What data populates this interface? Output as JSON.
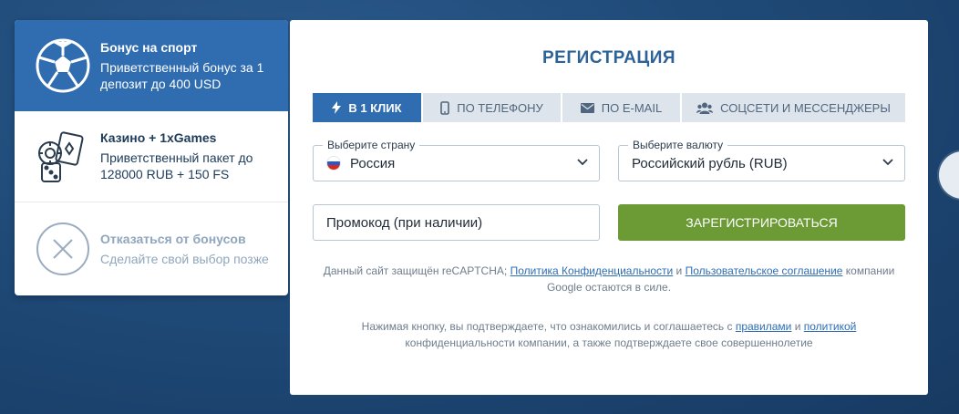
{
  "bonuses": [
    {
      "title": "Бонус на спорт",
      "desc_line1": "Приветственный бонус за 1",
      "desc_line2": "депозит до 400 USD",
      "icon": "soccer-ball-icon"
    },
    {
      "title": "Казино + 1xGames",
      "desc_line1": "Приветственный пакет до",
      "desc_line2": "128000 RUB + 150 FS",
      "icon": "casino-cards-dice-icon"
    },
    {
      "title": "Отказаться от бонусов",
      "desc_line1": "Сделайте свой выбор позже",
      "desc_line2": "",
      "icon": "close-circle-icon"
    }
  ],
  "registration": {
    "title": "РЕГИСТРАЦИЯ",
    "tabs": [
      {
        "label": "В 1 КЛИК",
        "icon": "lightning-icon"
      },
      {
        "label": "ПО ТЕЛЕФОНУ",
        "icon": "phone-icon"
      },
      {
        "label": "ПО E-MAIL",
        "icon": "envelope-icon"
      },
      {
        "label": "СОЦСЕТИ И МЕССЕНДЖЕРЫ",
        "icon": "users-icon"
      }
    ],
    "country": {
      "legend": "Выберите страну",
      "value": "Россия"
    },
    "currency": {
      "legend": "Выберите валюту",
      "value": "Российский рубль (RUB)"
    },
    "promo": {
      "placeholder": "Промокод (при наличии)"
    },
    "submit_label": "ЗАРЕГИСТРИРОВАТЬСЯ",
    "recaptcha": {
      "text1": "Данный сайт защищён reCAPTCHA; ",
      "link1": "Политика Конфиденциальности",
      "text2": " и ",
      "link2": "Пользовательское соглашение",
      "text3": " компании Google остаются в силе."
    },
    "consent": {
      "text1": "Нажимая кнопку, вы подтверждаете, что ознакомились и соглашаетесь с ",
      "link1": "правилами",
      "text2": " и ",
      "link2": "политикой",
      "text3": " конфиденциальности компании, а также подтверждаете свое совершеннолетие"
    }
  },
  "colors": {
    "accent": "#2f6cb0",
    "submit": "#6c9a34",
    "title": "#2d6296"
  }
}
